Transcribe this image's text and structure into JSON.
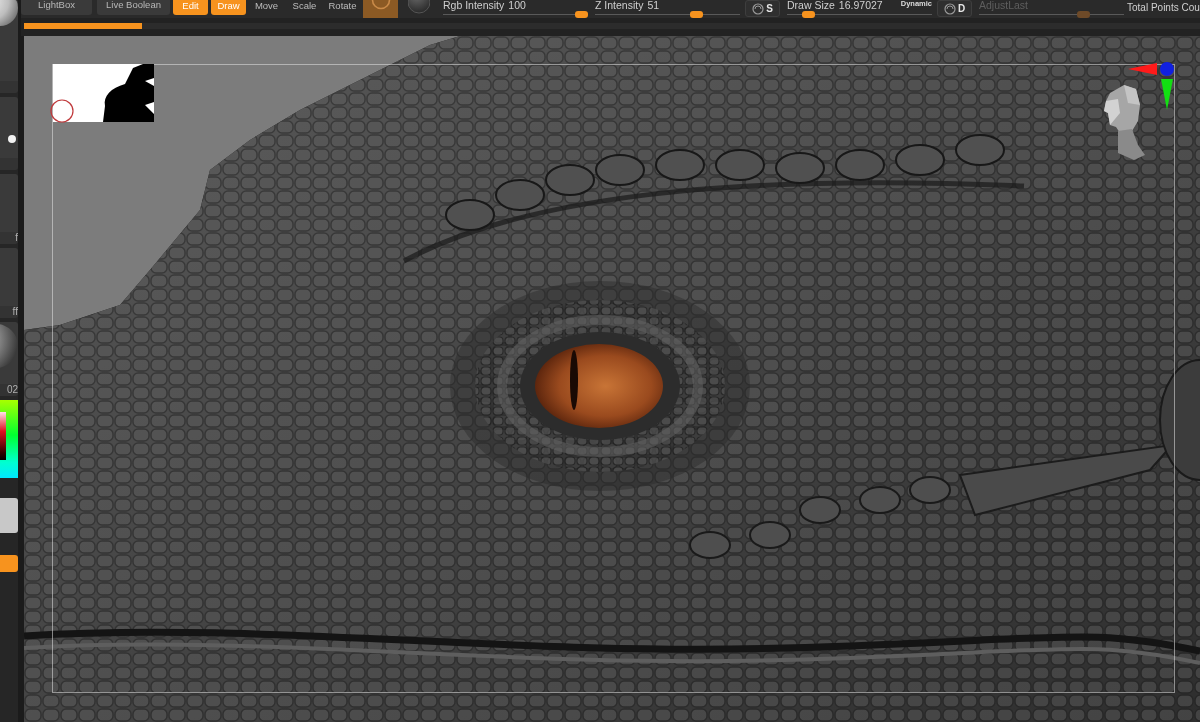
{
  "top_bar": {
    "items": [
      {
        "kind": "button",
        "label": "LightBox"
      },
      {
        "kind": "button",
        "label": "Live Boolean"
      },
      {
        "kind": "mode",
        "label": "Edit",
        "on": true
      },
      {
        "kind": "mode",
        "label": "Draw",
        "on": true
      },
      {
        "kind": "mode",
        "label": "Move",
        "on": false
      },
      {
        "kind": "mode",
        "label": "Scale",
        "on": false
      },
      {
        "kind": "mode",
        "label": "Rotate",
        "on": false
      },
      {
        "kind": "icon_toggle",
        "on": true
      },
      {
        "kind": "icon"
      },
      {
        "kind": "slider",
        "label": "Rgb Intensity",
        "reading": "100",
        "level": 1,
        "disabled": false
      },
      {
        "kind": "slider",
        "label": "Z Intensity",
        "reading": "51",
        "level": 0.72,
        "disabled": false
      },
      {
        "kind": "key",
        "label": "S"
      },
      {
        "kind": "slider",
        "label": "Draw Size",
        "reading": "16.97027",
        "level": 0.11,
        "disabled": false,
        "toggle": "Dynamic"
      },
      {
        "kind": "key",
        "label": "D"
      },
      {
        "kind": "slider",
        "label": "AdjustLast",
        "level": 0.74,
        "disabled": true
      },
      {
        "kind": "label",
        "label": "Total Points Cou"
      }
    ]
  },
  "progress": {
    "level": 0.1
  },
  "left_shelf": {
    "items": [
      {
        "kind": "brush"
      },
      {
        "kind": "stroke"
      },
      {
        "kind": "tile",
        "label": "f"
      },
      {
        "kind": "tile",
        "label": "ff"
      },
      {
        "kind": "material",
        "label": "02"
      },
      {
        "kind": "color_picker"
      },
      {
        "kind": "swatch",
        "color": "#c8c8c8"
      },
      {
        "kind": "chip",
        "color": "#f7931e"
      }
    ]
  }
}
